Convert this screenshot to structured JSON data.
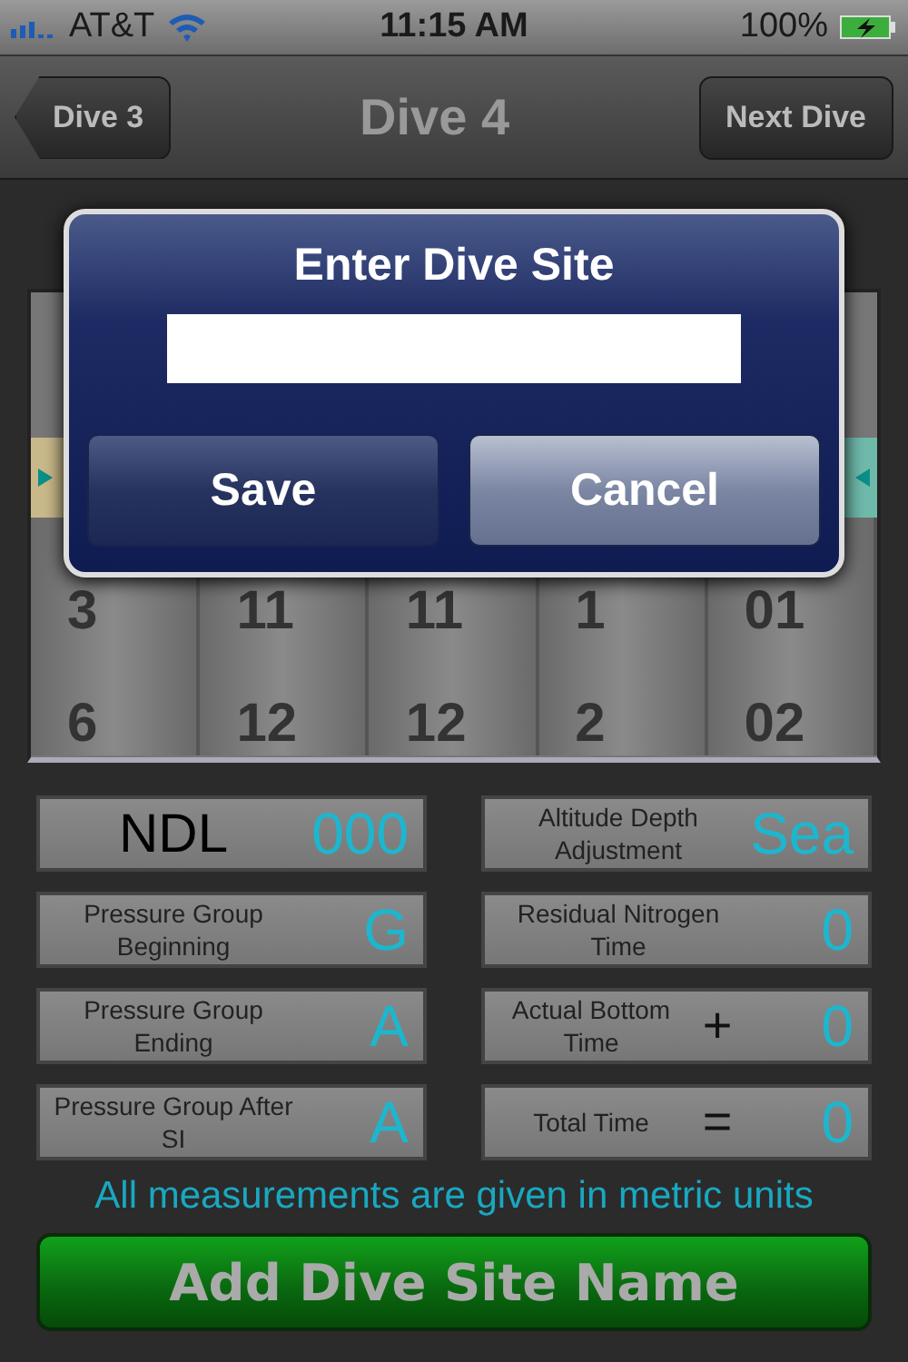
{
  "status_bar": {
    "carrier": "AT&T",
    "time": "11:15 AM",
    "battery": "100%",
    "charging": true
  },
  "nav": {
    "back": "Dive 3",
    "title": "Dive 4",
    "next": "Next Dive"
  },
  "picker": {
    "rows": [
      [
        "3",
        "11",
        "11",
        "1",
        "01"
      ],
      [
        "6",
        "12",
        "12",
        "2",
        "02"
      ]
    ]
  },
  "dialog": {
    "title": "Enter Dive Site",
    "buttons": [
      {
        "label": "Save",
        "kind": "secondary"
      },
      {
        "label": "Cancel",
        "kind": "primary"
      }
    ]
  },
  "cards": [
    {
      "label": "NDL",
      "value": "000",
      "kind": "big"
    },
    {
      "label": "Altitude Depth Adjustment",
      "value": "Sea",
      "kind": "small"
    },
    {
      "label": "Pressure Group Beginning",
      "value": "G",
      "kind": "small"
    },
    {
      "label": "Residual Nitrogen Time",
      "value": "0",
      "kind": "small"
    },
    {
      "label": "Pressure Group Ending",
      "value": "A",
      "kind": "small"
    },
    {
      "label": "Actual Bottom Time",
      "operator": "+",
      "value": "0",
      "kind": "small"
    },
    {
      "label": "Pressure Group After SI",
      "value": "A",
      "kind": "small"
    },
    {
      "label": "Total Time",
      "operator": "=",
      "value": "0",
      "kind": "small"
    }
  ],
  "note": "All measurements are given in metric units",
  "action": "Add Dive Site Name"
}
